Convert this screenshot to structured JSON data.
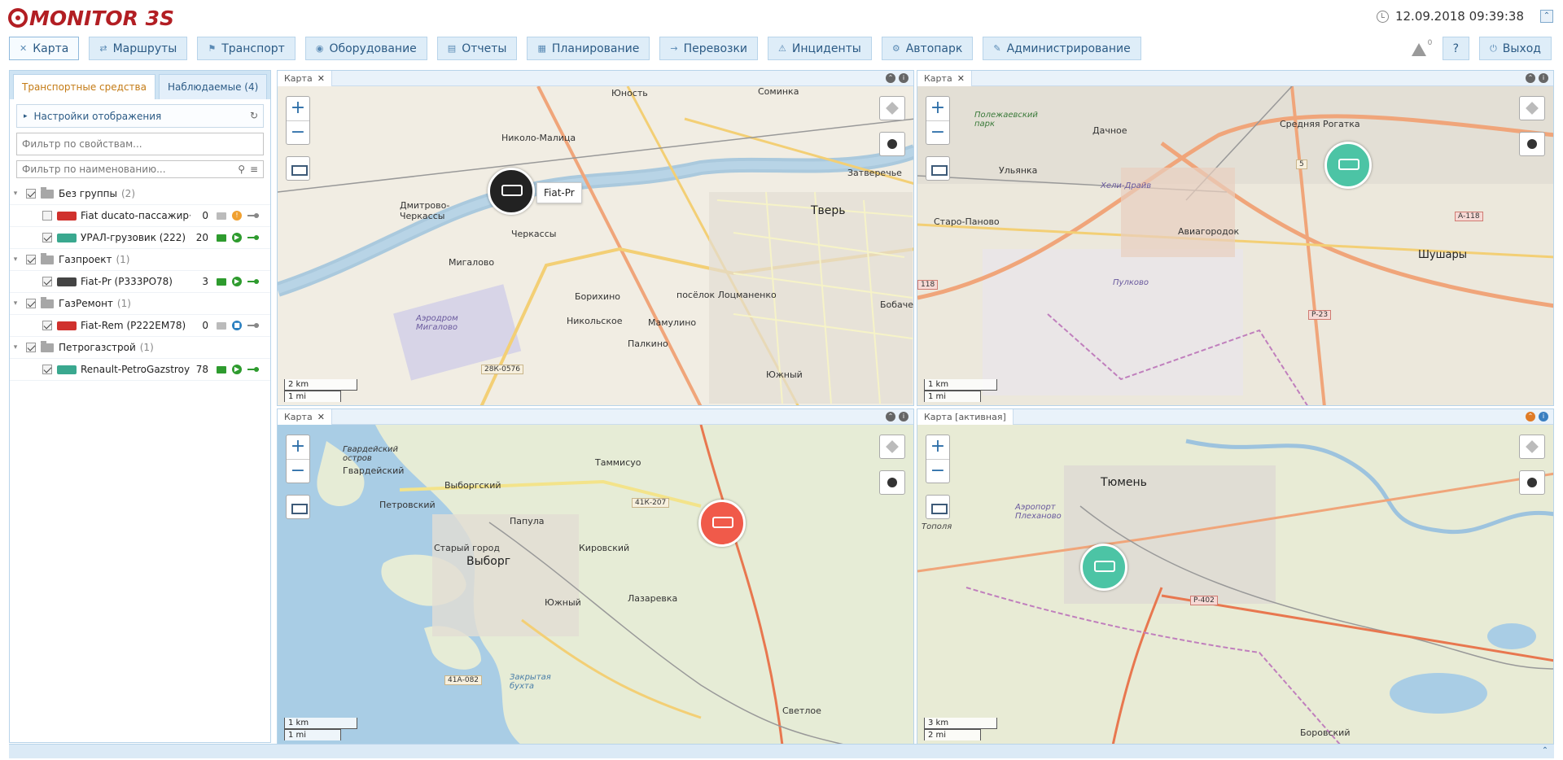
{
  "app": {
    "title": "MONITOR 3S",
    "datetime": "12.09.2018 09:39:38"
  },
  "nav": [
    {
      "icon": "map-icon",
      "label": "Карта",
      "active": true
    },
    {
      "icon": "routes-icon",
      "label": "Маршруты"
    },
    {
      "icon": "flag-icon",
      "label": "Транспорт"
    },
    {
      "icon": "rss-icon",
      "label": "Оборудование"
    },
    {
      "icon": "report-icon",
      "label": "Отчеты"
    },
    {
      "icon": "calendar-icon",
      "label": "Планирование"
    },
    {
      "icon": "arrow-icon",
      "label": "Перевозки"
    },
    {
      "icon": "warning-icon",
      "label": "Инциденты"
    },
    {
      "icon": "gear-icon",
      "label": "Автопарк"
    },
    {
      "icon": "wrench-icon",
      "label": "Администрирование"
    }
  ],
  "navright": {
    "alert_count": "0",
    "help": "?",
    "logout": "Выход"
  },
  "sidebar": {
    "tabs": [
      "Транспортные средства",
      "Наблюдаемые (4)"
    ],
    "settings_label": "Настройки отображения",
    "filter_props_placeholder": "Фильтр по свойствам...",
    "filter_name_placeholder": "Фильтр по наименованию...",
    "groups": [
      {
        "name": "Без группы",
        "count": "(2)",
        "vehicles": [
          {
            "name": "Fiat ducato-пассажир···",
            "num": "0",
            "color": "#d0312d",
            "checked": false,
            "active": false,
            "status": "warn"
          },
          {
            "name": "УРАЛ-грузовик (222)",
            "num": "20",
            "color": "#3aa88f",
            "checked": true,
            "active": true,
            "status": "play"
          }
        ]
      },
      {
        "name": "Газпроект",
        "count": "(1)",
        "vehicles": [
          {
            "name": "Fiat-Pr (Р333РО78)",
            "num": "3",
            "color": "#444",
            "checked": true,
            "active": true,
            "status": "play"
          }
        ]
      },
      {
        "name": "ГазРемонт",
        "count": "(1)",
        "vehicles": [
          {
            "name": "Fiat-Rem (Р222ЕМ78)",
            "num": "0",
            "color": "#d0312d",
            "checked": true,
            "active": false,
            "status": "stop"
          }
        ]
      },
      {
        "name": "Петрогазстрой",
        "count": "(1)",
        "vehicles": [
          {
            "name": "Renault-PetroGazstroy···",
            "num": "78",
            "color": "#3aa88f",
            "checked": true,
            "active": true,
            "status": "play"
          }
        ]
      }
    ]
  },
  "maps": [
    {
      "title": "Карта",
      "scale_km": "2 km",
      "scale_mi": "1 mi",
      "places": [
        "Юность",
        "Соминка",
        "Николо-Малица",
        "Дмитрово-Черкассы",
        "Черкассы",
        "Тверь",
        "Затверечье",
        "Мигалово",
        "Борихино",
        "посёлок Лоцманенко",
        "Бобачев",
        "Никольское",
        "Мамулино",
        "Палкино",
        "Южный",
        "Аэродром Мигалово"
      ],
      "roads": [
        "28К-0576"
      ],
      "marker_label": "Fiat-Pr"
    },
    {
      "title": "Карта",
      "scale_km": "1 km",
      "scale_mi": "1 mi",
      "places": [
        "Полежаевский парк",
        "Дачное",
        "Средняя Рогатка",
        "Ульянка",
        "Хели-Драйв",
        "Старо-Паново",
        "Авиагородок",
        "Шушары",
        "Пулково"
      ],
      "roads": [
        "А-118",
        "Р-23",
        "118",
        "5"
      ]
    },
    {
      "title": "Карта",
      "scale_km": "1 km",
      "scale_mi": "1 mi",
      "places": [
        "Гвардейский остров",
        "Гвардейский",
        "Выборгский",
        "Таммисуо",
        "Петровский",
        "Папула",
        "Старый город",
        "Выборг",
        "Кировский",
        "Южный",
        "Лазаревка",
        "Закрытая бухта",
        "Светлое"
      ],
      "roads": [
        "41К-207",
        "41А-082"
      ]
    },
    {
      "title": "Карта [активная]",
      "scale_km": "3 km",
      "scale_mi": "2 mi",
      "places": [
        "Тюмень",
        "Аэропорт Плеханово",
        "Тополя",
        "Боровский"
      ],
      "roads": [
        "Р-402"
      ]
    }
  ]
}
